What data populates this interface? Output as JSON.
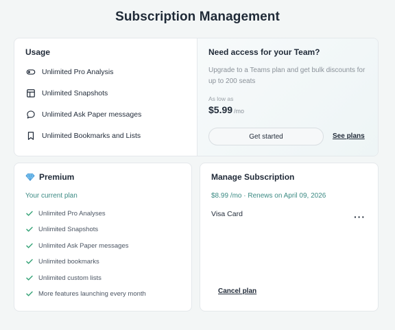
{
  "page": {
    "title": "Subscription Management"
  },
  "usage": {
    "heading": "Usage",
    "items": [
      {
        "label": "Unlimited Pro Analysis",
        "icon": "toggle-icon"
      },
      {
        "label": "Unlimited Snapshots",
        "icon": "table-icon"
      },
      {
        "label": "Unlimited Ask Paper messages",
        "icon": "chat-bubble-icon"
      },
      {
        "label": "Unlimited Bookmarks and Lists",
        "icon": "bookmark-icon"
      }
    ]
  },
  "team": {
    "heading": "Need access for your Team?",
    "description": "Upgrade to a Teams plan and get bulk discounts for up to 200 seats",
    "as_low_as": "As low as",
    "price": "$5.99",
    "price_unit": "/mo",
    "get_started_label": "Get started",
    "see_plans_label": "See plans"
  },
  "premium": {
    "title": "Premium",
    "icon": "diamond-icon",
    "current_plan": "Your current plan",
    "features": [
      "Unlimited Pro Analyses",
      "Unlimited Snapshots",
      "Unlimited Ask Paper messages",
      "Unlimited bookmarks",
      "Unlimited custom lists",
      "More features launching every month"
    ]
  },
  "manage": {
    "heading": "Manage Subscription",
    "renewal": "$8.99 /mo · Renews on April 09, 2026",
    "payment_method": "Visa Card",
    "more_label": "···",
    "cancel_label": "Cancel plan"
  },
  "colors": {
    "accent": "#3b8a83",
    "check": "#3aa57a",
    "background": "#f3f6f6"
  }
}
